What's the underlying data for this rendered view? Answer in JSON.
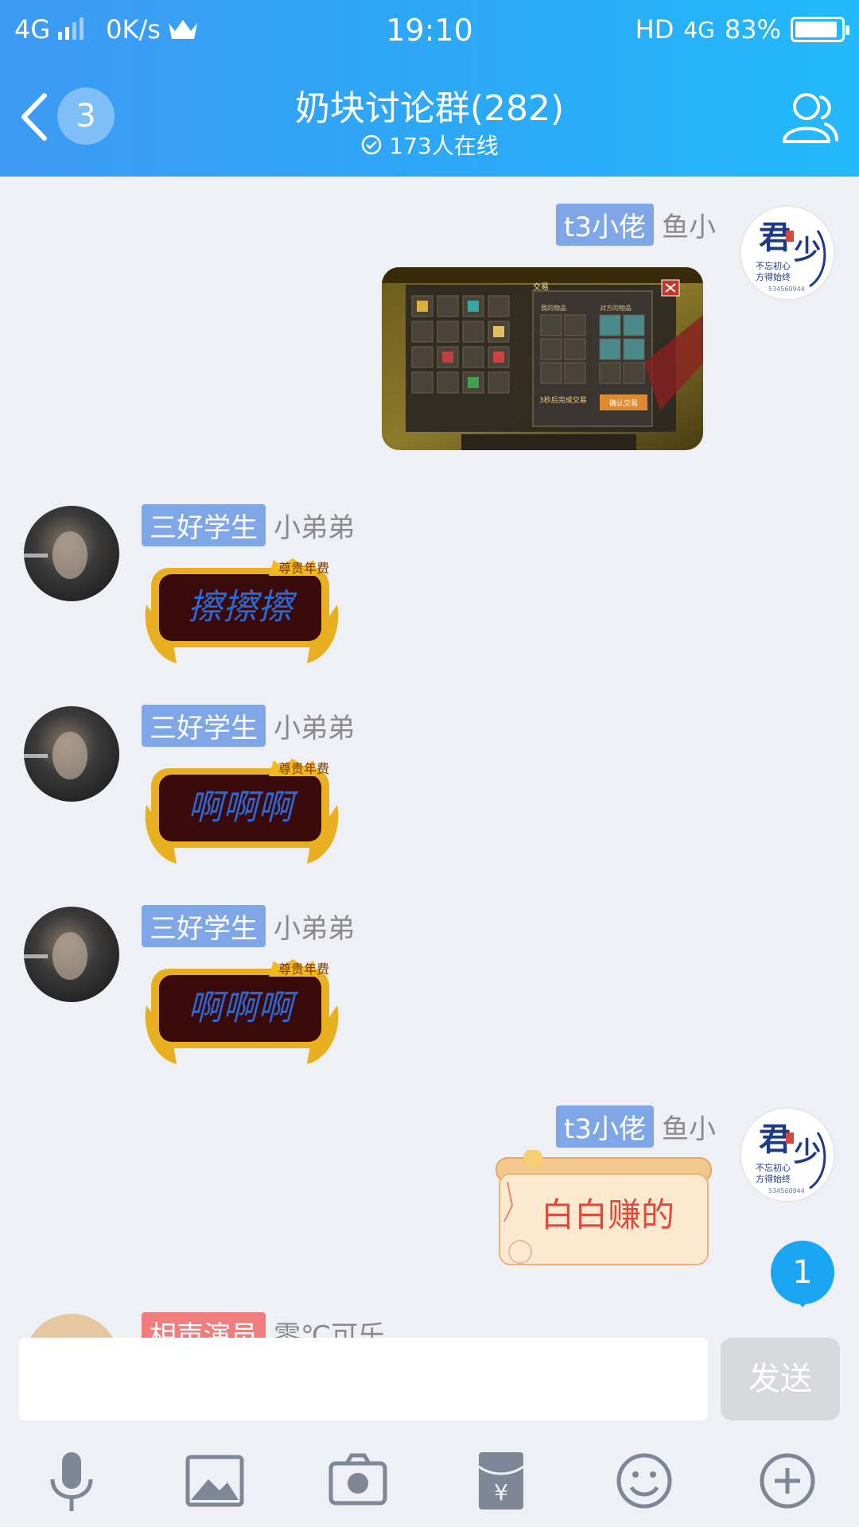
{
  "status_bar": {
    "network": "4G",
    "speed": "0K/s",
    "time": "19:10",
    "hd": "HD",
    "network_right": "4G",
    "battery": "83%",
    "battery_level": 0.83
  },
  "header": {
    "unread_count": "3",
    "title": "奶块讨论群(282)",
    "online": "173人在线"
  },
  "messages": [
    {
      "side": "right",
      "badge": "t3小佬",
      "nickname": "鱼小",
      "type": "game-screenshot",
      "game": {
        "trade_title": "交易",
        "my_items": "我的物品",
        "their_items": "对方的物品",
        "countdown": "3秒后完成交易",
        "confirm": "确认交易"
      }
    },
    {
      "side": "left",
      "badge": "三好学生",
      "nickname": "小弟弟",
      "type": "sticker",
      "text": "擦擦擦",
      "tag": "尊贵年费"
    },
    {
      "side": "left",
      "badge": "三好学生",
      "nickname": "小弟弟",
      "type": "sticker",
      "text": "啊啊啊",
      "tag": "尊贵年费"
    },
    {
      "side": "left",
      "badge": "三好学生",
      "nickname": "小弟弟",
      "type": "sticker",
      "text": "啊啊啊",
      "tag": "尊贵年费"
    },
    {
      "side": "right",
      "badge": "t3小佬",
      "nickname": "鱼小",
      "type": "scroll-sticker",
      "text": "白白赚的"
    },
    {
      "side": "left",
      "badge": "相声演员",
      "nickname": "零℃可乐",
      "type": "partial"
    }
  ],
  "logo_avatar": {
    "chars": "君少",
    "motto": "不忘初心 方得始终",
    "number": "534560944"
  },
  "new_message_count": "1",
  "input": {
    "value": "",
    "send_label": "发送"
  },
  "toolbar": [
    "microphone-icon",
    "image-icon",
    "camera-icon",
    "red-packet-icon",
    "emoji-icon",
    "plus-icon"
  ],
  "colors": {
    "header_start": "#3e9af3",
    "header_end": "#23b9fb",
    "badge_blue": "#7fa7e8",
    "badge_red": "#f07c7c",
    "accent": "#1aa6f2"
  }
}
